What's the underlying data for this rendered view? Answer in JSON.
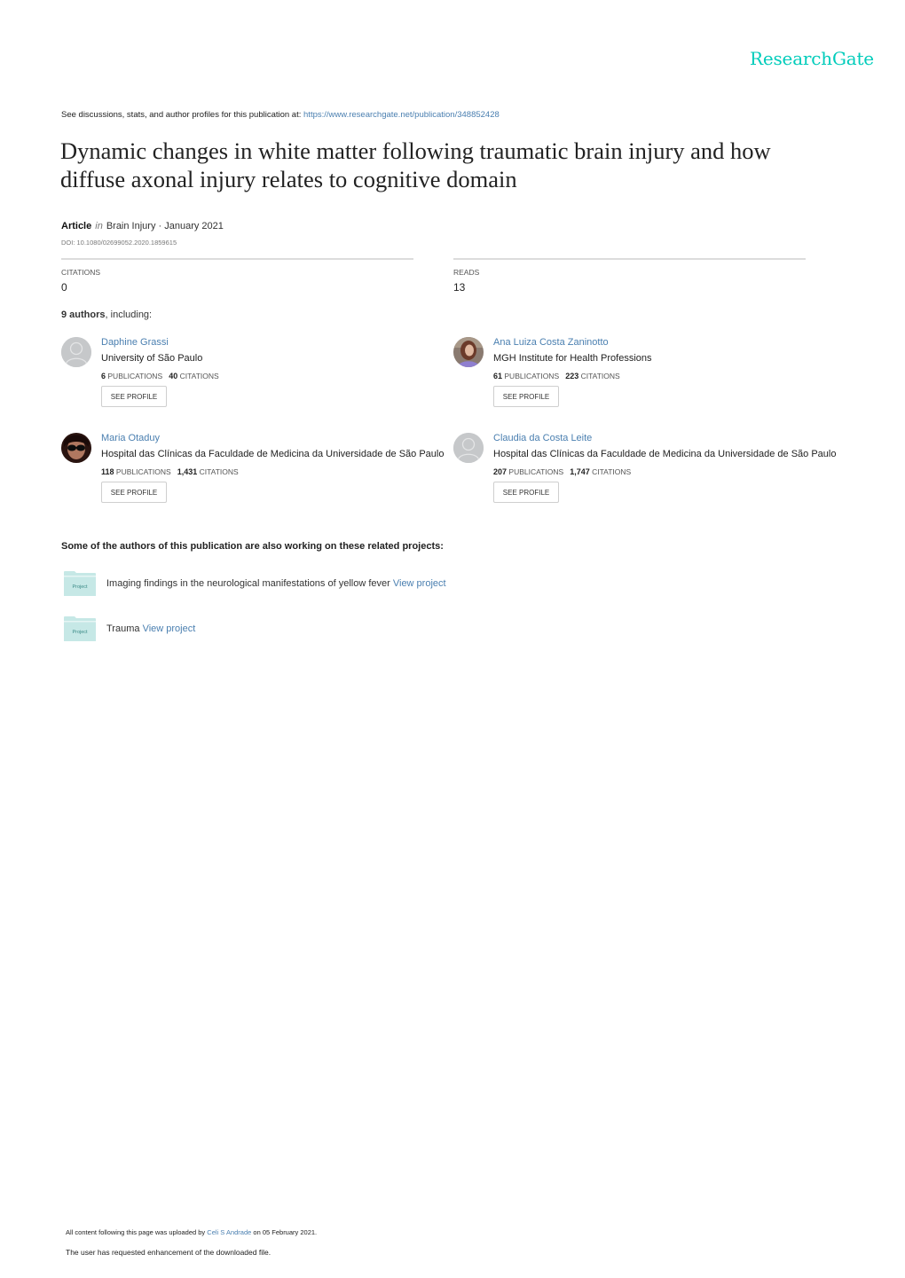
{
  "brand": {
    "name": "ResearchGate",
    "color": "#00ccbb"
  },
  "header": {
    "see_discussions_text": "See discussions, stats, and author profiles for this publication at: ",
    "publication_url": "https://www.researchgate.net/publication/348852428"
  },
  "publication": {
    "title": "Dynamic changes in white matter following traumatic brain injury and how diffuse axonal injury relates to cognitive domain",
    "type": "Article",
    "in_label": "in",
    "journal_date": "Brain Injury · January 2021",
    "doi": "DOI: 10.1080/02699052.2020.1859615"
  },
  "stats": {
    "citations_label": "CITATIONS",
    "citations_value": "0",
    "reads_label": "READS",
    "reads_value": "13"
  },
  "authors_section": {
    "count_bold": "9 authors",
    "count_suffix": ", including:"
  },
  "authors": [
    {
      "name": "Daphine Grassi",
      "affiliation": "University of São Paulo",
      "publications": "6",
      "publications_label": "PUBLICATIONS",
      "citations": "40",
      "citations_label": "CITATIONS",
      "button": "SEE PROFILE",
      "avatar": "placeholder"
    },
    {
      "name": "Ana Luiza Costa Zaninotto",
      "affiliation": "MGH Institute for Health Professions",
      "publications": "61",
      "publications_label": "PUBLICATIONS",
      "citations": "223",
      "citations_label": "CITATIONS",
      "button": "SEE PROFILE",
      "avatar": "photo"
    },
    {
      "name": "Maria Otaduy",
      "affiliation": "Hospital das Clínicas da Faculdade de Medicina da Universidade de São Paulo",
      "publications": "118",
      "publications_label": "PUBLICATIONS",
      "citations": "1,431",
      "citations_label": "CITATIONS",
      "button": "SEE PROFILE",
      "avatar": "photo"
    },
    {
      "name": "Claudia da Costa Leite",
      "affiliation": "Hospital das Clínicas da Faculdade de Medicina da Universidade de São Paulo",
      "publications": "207",
      "publications_label": "PUBLICATIONS",
      "citations": "1,747",
      "citations_label": "CITATIONS",
      "button": "SEE PROFILE",
      "avatar": "placeholder"
    }
  ],
  "projects_section": {
    "heading": "Some of the authors of this publication are also working on these related projects:",
    "folder_label": "Project",
    "items": [
      {
        "title": "Imaging findings in the neurological manifestations of yellow fever",
        "link": "View project"
      },
      {
        "title": "Trauma",
        "link": "View project"
      }
    ]
  },
  "footer": {
    "upload_prefix": "All content following this page was uploaded by ",
    "uploader": "Celi S Andrade",
    "upload_suffix": " on 05 February 2021.",
    "enhancement_note": "The user has requested enhancement of the downloaded file."
  }
}
